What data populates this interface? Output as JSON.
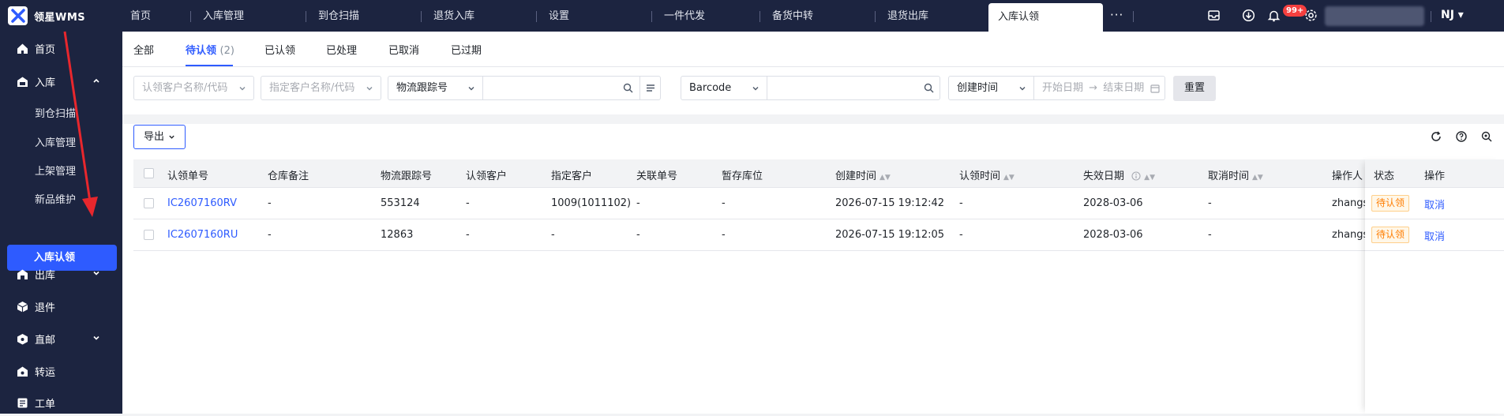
{
  "app": {
    "name": "领星WMS",
    "user_initials": "NJ",
    "notification_badge": "99+"
  },
  "nav_tabs": [
    {
      "label": "首页"
    },
    {
      "label": "入库管理"
    },
    {
      "label": "到仓扫描"
    },
    {
      "label": "退货入库"
    },
    {
      "label": "设置"
    },
    {
      "label": "一件代发"
    },
    {
      "label": "备货中转"
    },
    {
      "label": "退货出库"
    },
    {
      "label": "入库认领",
      "active": true
    }
  ],
  "nav_more": "···",
  "sidebar": {
    "items": [
      {
        "label": "首页",
        "icon": "home-icon"
      },
      {
        "label": "入库",
        "icon": "inbound-icon",
        "expanded": true
      },
      {
        "label": "出库",
        "icon": "outbound-icon"
      },
      {
        "label": "退件",
        "icon": "return-icon"
      },
      {
        "label": "直邮",
        "icon": "direct-mail-icon"
      },
      {
        "label": "转运",
        "icon": "transfer-icon"
      },
      {
        "label": "工单",
        "icon": "ticket-icon"
      }
    ],
    "sub_items": [
      "到仓扫描",
      "入库管理",
      "上架管理",
      "新品维护",
      "入库认领"
    ]
  },
  "status_tabs": [
    {
      "label": "全部"
    },
    {
      "label": "待认领",
      "count": "(2)",
      "active": true
    },
    {
      "label": "已认领"
    },
    {
      "label": "已处理"
    },
    {
      "label": "已取消"
    },
    {
      "label": "已过期"
    }
  ],
  "filters": {
    "claim_customer_placeholder": "认领客户名称/代码",
    "assigned_customer_placeholder": "指定客户名称/代码",
    "tracking_type": "物流跟踪号",
    "barcode_type": "Barcode",
    "time_type": "创建时间",
    "start_date_placeholder": "开始日期",
    "end_date_placeholder": "结束日期",
    "date_arrow": "→",
    "reset_label": "重置"
  },
  "toolbar": {
    "export_label": "导出"
  },
  "table": {
    "headers": [
      "认领单号",
      "仓库备注",
      "物流跟踪号",
      "认领客户",
      "指定客户",
      "关联单号",
      "暂存库位",
      "创建时间",
      "认领时间",
      "失效日期",
      "取消时间",
      "操作人",
      "状态",
      "操作"
    ],
    "rows": [
      {
        "claim_no": "IC2607160RV",
        "warehouse_note": "-",
        "tracking_no": "553124",
        "claim_customer": "-",
        "assigned_customer": "1009(1011102)",
        "related_no": "-",
        "storage_location": "-",
        "created_at": "2026-07-15 19:12:42",
        "claimed_at": "-",
        "expiry_date": "2028-03-06",
        "cancelled_at": "-",
        "operator": "zhangsa",
        "status": "待认领",
        "action": "取消"
      },
      {
        "claim_no": "IC2607160RU",
        "warehouse_note": "-",
        "tracking_no": "12863",
        "claim_customer": "-",
        "assigned_customer": "-",
        "related_no": "-",
        "storage_location": "-",
        "created_at": "2026-07-15 19:12:05",
        "claimed_at": "-",
        "expiry_date": "2028-03-06",
        "cancelled_at": "-",
        "operator": "zhangsa",
        "status": "待认领",
        "action": "取消"
      }
    ]
  },
  "colors": {
    "primary": "#2e5bff",
    "nav_bg": "#1c2440",
    "status_pending": "#ff7d00",
    "arrow": "#e8272d"
  }
}
